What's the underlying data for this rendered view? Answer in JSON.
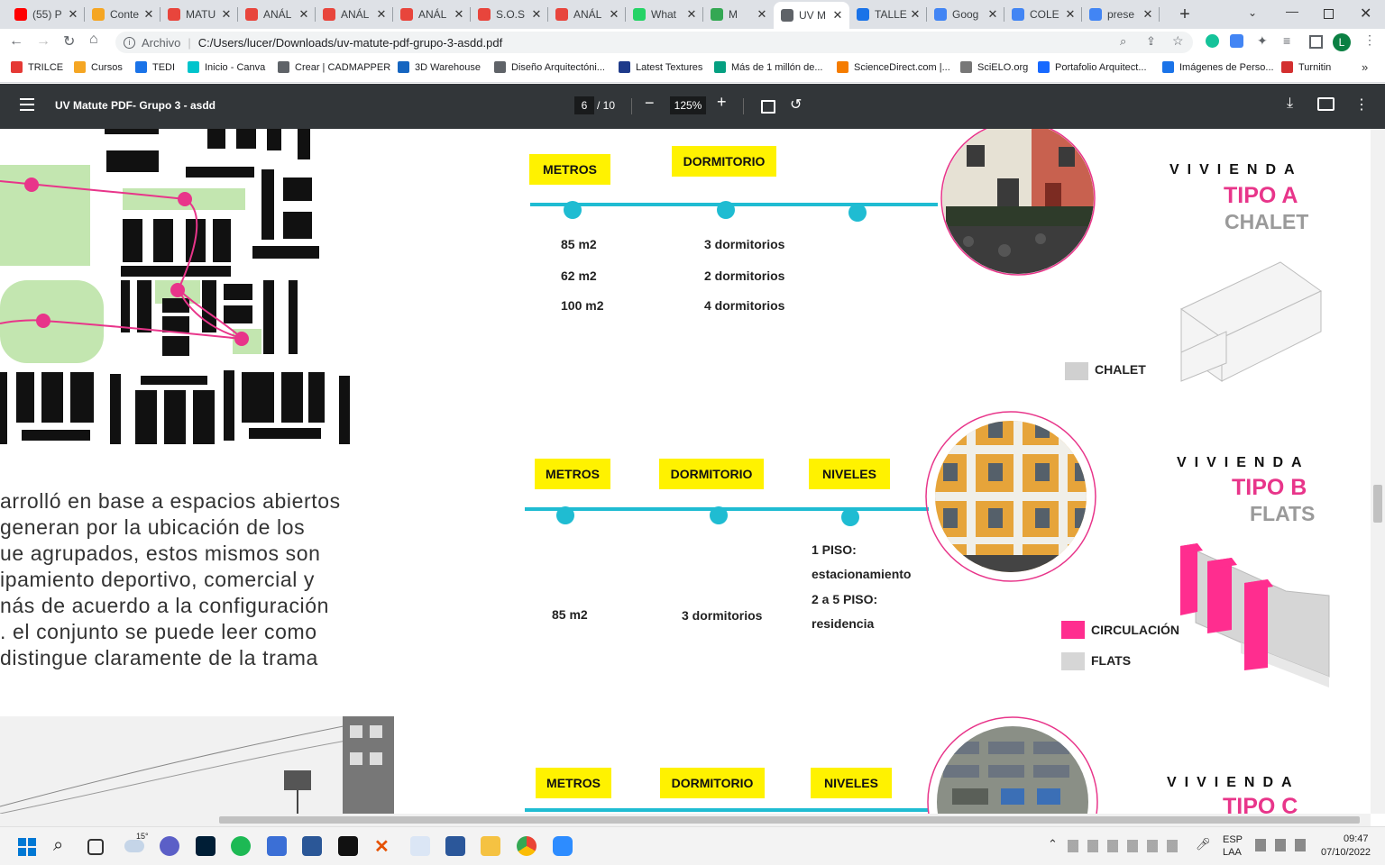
{
  "browser": {
    "tabs": [
      {
        "title": "(55) P",
        "color": "#ff0000"
      },
      {
        "title": "Conte",
        "color": "#f5a623"
      },
      {
        "title": "MATU",
        "color": "#e8453c"
      },
      {
        "title": "ANÁL",
        "color": "#e8453c"
      },
      {
        "title": "ANÁL",
        "color": "#e8453c"
      },
      {
        "title": "ANÁL",
        "color": "#e8453c"
      },
      {
        "title": "S.O.S",
        "color": "#e8453c"
      },
      {
        "title": "ANÁL",
        "color": "#e8453c"
      },
      {
        "title": "What",
        "color": "#25d366"
      },
      {
        "title": "M",
        "color": "#34a853"
      },
      {
        "title": "UV M",
        "color": "#5f6368"
      },
      {
        "title": "TALLE",
        "color": "#1a73e8"
      },
      {
        "title": "Goog",
        "color": "#4285f4"
      },
      {
        "title": "COLE",
        "color": "#4285f4"
      },
      {
        "title": "prese",
        "color": "#4285f4"
      }
    ],
    "address_scheme": "Archivo",
    "address": "C:/Users/lucer/Downloads/uv-matute-pdf-grupo-3-asdd.pdf",
    "profile_letter": "L",
    "bookmarks": [
      {
        "label": "TRILCE",
        "color": "#e53935"
      },
      {
        "label": "Cursos",
        "color": "#f5a623"
      },
      {
        "label": "TEDI",
        "color": "#1a73e8"
      },
      {
        "label": "Inicio - Canva",
        "color": "#00c4cc"
      },
      {
        "label": "Crear | CADMAPPER",
        "color": "#5f6368"
      },
      {
        "label": "3D Warehouse",
        "color": "#1565c0"
      },
      {
        "label": "Diseño Arquitectóni...",
        "color": "#5f6368"
      },
      {
        "label": "Latest Textures",
        "color": "#1e3a8a"
      },
      {
        "label": "Más de 1 millón de...",
        "color": "#05a081"
      },
      {
        "label": "ScienceDirect.com |...",
        "color": "#f57c00"
      },
      {
        "label": "SciELO.org",
        "color": "#777"
      },
      {
        "label": "Portafolio Arquitect...",
        "color": "#1769ff"
      },
      {
        "label": "Imágenes de Perso...",
        "color": "#1a73e8"
      },
      {
        "label": "Turnitin",
        "color": "#d32f2f"
      }
    ]
  },
  "pdf": {
    "title": "UV Matute PDF- Grupo 3 - asdd",
    "page_current": "6",
    "page_total": "/ 10",
    "zoom": "125%"
  },
  "document": {
    "paragraph_lines": [
      "arrolló en base a espacios abiertos",
      "generan por la ubicación de los",
      "ue agrupados, estos mismos son",
      "ipamiento deportivo, comercial y",
      "nás de acuerdo a la configuración",
      ". el conjunto se puede leer como",
      "distingue claramente de la trama"
    ],
    "label_metros": "METROS",
    "label_dormitorio": "DORMITORIO",
    "label_niveles": "NIVELES",
    "vivienda": "VIVIENDA",
    "tipo_a": {
      "tipo": "TIPO A",
      "name": "CHALET",
      "metros": [
        "85 m2",
        "62 m2",
        "100 m2"
      ],
      "dormitorios": [
        "3 dormitorios",
        "2 dormitorios",
        "4 dormitorios"
      ],
      "legend": "CHALET"
    },
    "tipo_b": {
      "tipo": "TIPO B",
      "name": "FLATS",
      "metros": "85 m2",
      "dormitorios": "3 dormitorios",
      "niveles": [
        "1 PISO:",
        "estacionamiento",
        "2 a 5 PISO:",
        "residencia"
      ],
      "legend_circ": "CIRCULACIÓN",
      "legend_flats": "FLATS"
    },
    "tipo_c": {
      "tipo": "TIPO C"
    }
  },
  "taskbar": {
    "temp": "15°",
    "lang1": "ESP",
    "lang2": "LAA",
    "time": "09:47",
    "date": "07/10/2022"
  },
  "colors": {
    "accent_cyan": "#1fbcd2",
    "label_yellow": "#fff200",
    "pink": "#e8358a"
  }
}
